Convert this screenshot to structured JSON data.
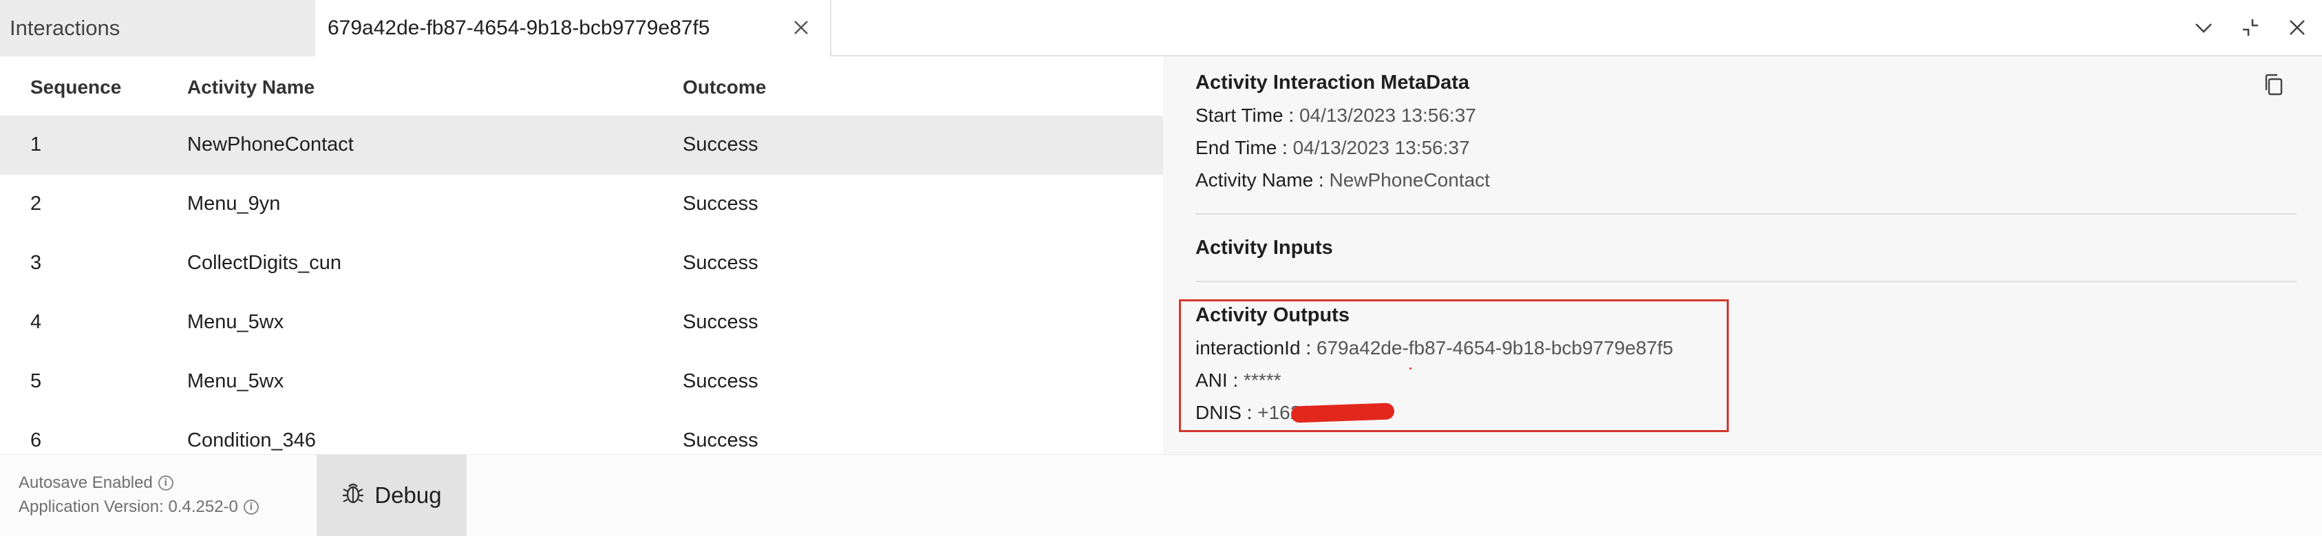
{
  "tabs": {
    "static_label": "Interactions",
    "active_label": "679a42de-fb87-4654-9b18-bcb9779e87f5"
  },
  "window_controls": [
    "chevron-down-icon",
    "collapse-icon",
    "close-icon"
  ],
  "table": {
    "headers": {
      "sequence": "Sequence",
      "activity_name": "Activity Name",
      "outcome": "Outcome"
    },
    "rows": [
      {
        "sequence": "1",
        "activity_name": "NewPhoneContact",
        "outcome": "Success",
        "selected": true
      },
      {
        "sequence": "2",
        "activity_name": "Menu_9yn",
        "outcome": "Success"
      },
      {
        "sequence": "3",
        "activity_name": "CollectDigits_cun",
        "outcome": "Success"
      },
      {
        "sequence": "4",
        "activity_name": "Menu_5wx",
        "outcome": "Success"
      },
      {
        "sequence": "5",
        "activity_name": "Menu_5wx",
        "outcome": "Success"
      },
      {
        "sequence": "6",
        "activity_name": "Condition_346",
        "outcome": "Success"
      }
    ]
  },
  "detail": {
    "metadata_title": "Activity Interaction MetaData",
    "start_time_label": "Start Time : ",
    "start_time": "04/13/2023 13:56:37",
    "end_time_label": "End Time : ",
    "end_time": "04/13/2023 13:56:37",
    "activity_name_label": "Activity Name : ",
    "activity_name": "NewPhoneContact",
    "inputs_title": "Activity Inputs",
    "outputs_title": "Activity Outputs",
    "interaction_id_label": "interactionId : ",
    "interaction_id": "679a42de-fb87-4654-9b18-bcb9779e87f5",
    "ani_label": "ANI : ",
    "ani": "*****",
    "dnis_label": "DNIS : ",
    "dnis": "+1626"
  },
  "footer": {
    "autosave": "Autosave Enabled",
    "app_version": "Application Version: 0.4.252-0",
    "debug_label": "Debug"
  },
  "colors": {
    "highlight": "#d5372c",
    "selected_row": "#ebebeb",
    "panel_bg": "#f7f7f7"
  }
}
